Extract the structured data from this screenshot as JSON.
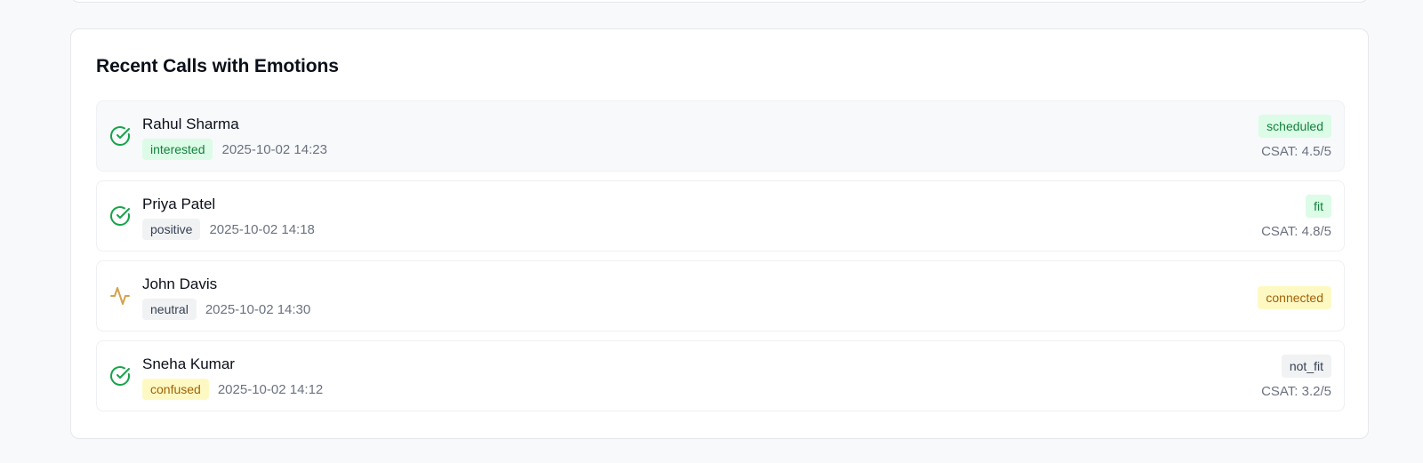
{
  "section": {
    "title": "Recent Calls with Emotions"
  },
  "calls": [
    {
      "name": "Rahul Sharma",
      "emotion": "interested",
      "emotion_color": "#15803d",
      "time": "2025-10-02 14:23",
      "outcome": "scheduled",
      "outcome_color": "#15803d",
      "csat": "CSAT: 4.5/5",
      "status_icon": "check-circle-icon"
    },
    {
      "name": "Priya Patel",
      "emotion": "positive",
      "emotion_color": "#374151",
      "time": "2025-10-02 14:18",
      "outcome": "fit",
      "outcome_color": "#15803d",
      "csat": "CSAT: 4.8/5",
      "status_icon": "check-circle-icon"
    },
    {
      "name": "John Davis",
      "emotion": "neutral",
      "emotion_color": "#374151",
      "time": "2025-10-02 14:30",
      "outcome": "connected",
      "outcome_color": "#a16207",
      "csat": "",
      "status_icon": "activity-icon"
    },
    {
      "name": "Sneha Kumar",
      "emotion": "confused",
      "emotion_color": "#a16207",
      "time": "2025-10-02 14:12",
      "outcome": "not_fit",
      "outcome_color": "#374151",
      "csat": "CSAT: 3.2/5",
      "status_icon": "check-circle-icon"
    }
  ]
}
